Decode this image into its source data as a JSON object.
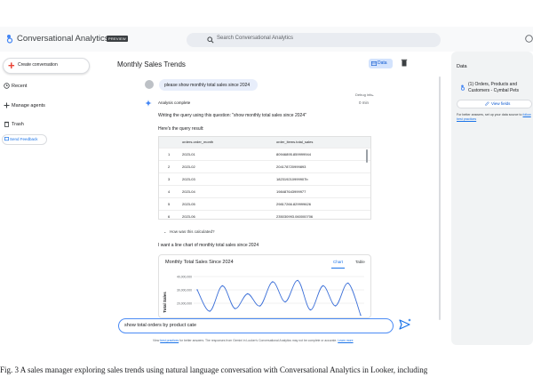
{
  "header": {
    "app_title": "Conversational Analytics",
    "preview_badge": "PREVIEW",
    "search_placeholder": "Search Conversational Analytics"
  },
  "sidebar": {
    "create_label": "Create conversation",
    "recent_label": "Recent",
    "agents_label": "Manage agents",
    "trash_label": "Trash",
    "feedback_label": "Send Feedback"
  },
  "main": {
    "title": "Monthly Sales Trends",
    "data_button": "Data",
    "user_message": "please show monthly total sales since 2024",
    "debug_info": "Debug info",
    "analysis_label": "Analysis complete",
    "analysis_time": "0 min",
    "writing_query": "Writing the query using this question: \"show monthly total sales since 2024\"",
    "query_result_label": "Here's the query result:",
    "how_calculated": "How was this calculated?",
    "line_chart_request": "I want a line chart of monthly total sales since 2024"
  },
  "table": {
    "columns": [
      "orders.order_month",
      "order_items.total_sales"
    ],
    "rows": [
      {
        "n": "1",
        "month": "2023-01",
        "sales": "80946895.859999944"
      },
      {
        "n": "2",
        "month": "2023-02",
        "sales": "204178720999893"
      },
      {
        "n": "3",
        "month": "2023-03",
        "sales": "182319210999907b"
      },
      {
        "n": "4",
        "month": "2023-04",
        "sales": "198487643999977"
      },
      {
        "n": "5",
        "month": "2023-05",
        "sales": "29817266.829999626"
      },
      {
        "n": "6",
        "month": "2023-06",
        "sales": "235030993.060000706"
      }
    ]
  },
  "chart_card": {
    "title": "Monthly Total Sales Since 2024",
    "tab_chart": "Chart",
    "tab_table": "Table"
  },
  "chart_data": {
    "type": "line",
    "ylabel": "Total Sales",
    "ylim": [
      10000000,
      42000000
    ],
    "yticks": [
      "40,000,000",
      "30,000,000",
      "20,000,000"
    ],
    "series": [
      {
        "values": [
          30000000,
          14000000,
          33000000,
          16000000,
          27000000,
          18000000,
          36000000,
          21000000,
          37000000,
          15000000,
          33000000,
          18000000,
          35000000,
          11000000
        ]
      }
    ]
  },
  "input": {
    "value": "show total orders by product cate"
  },
  "footnote": {
    "prefix": "View ",
    "link1": "best practices",
    "middle": " for better answers. The responses from Gemini in Looker's Conversational Analytics may not be complete or accurate. ",
    "link2": "Learn more"
  },
  "data_panel": {
    "title": "Data",
    "dataset_name": "(1) Orders, Products and Customers - Cymbal Pets",
    "view_fields": "View fields",
    "hint_prefix": "For better answers, set up your data source to",
    "hint_link": "follow best practices"
  },
  "caption": "Fig. 3   A sales manager exploring sales trends using natural language conversation with Conversational Analytics in Looker, including"
}
